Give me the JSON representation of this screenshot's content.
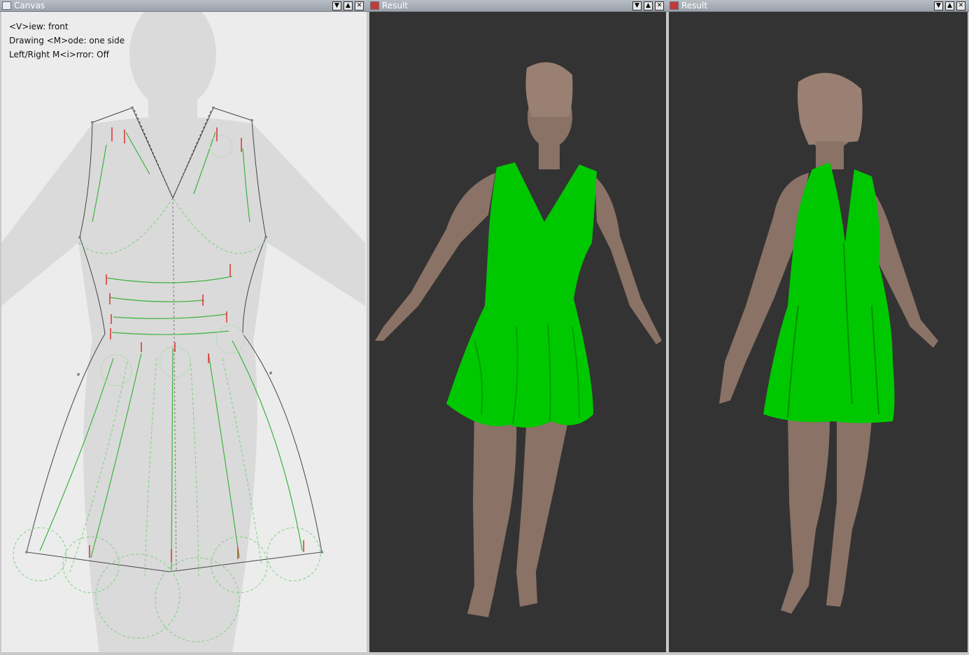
{
  "windows": {
    "canvas": {
      "title": "Canvas",
      "info": {
        "view": "<V>iew: front",
        "mode": "Drawing <M>ode: one side",
        "mirror": "Left/Right M<i>rror: Off"
      }
    },
    "result_front": {
      "title": "Result"
    },
    "result_back": {
      "title": "Result"
    }
  },
  "controls": {
    "minimize": "▼",
    "maximize": "▲",
    "close": "✕"
  },
  "colors": {
    "garment": "#00c800",
    "skin": "#8a7266",
    "viewport": "#333333",
    "canvas": "#ececec"
  }
}
